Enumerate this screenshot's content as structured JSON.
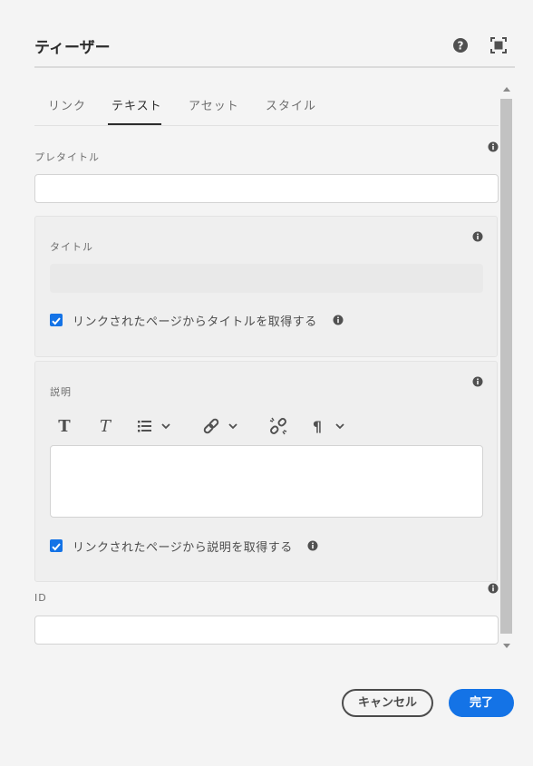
{
  "dialog": {
    "title": "ティーザー",
    "help_icon": "help-circle-icon",
    "fullscreen_icon": "fullscreen-icon"
  },
  "tabs": [
    {
      "label": "リンク",
      "active": false
    },
    {
      "label": "テキスト",
      "active": true
    },
    {
      "label": "アセット",
      "active": false
    },
    {
      "label": "スタイル",
      "active": false
    }
  ],
  "fields": {
    "pretitle": {
      "label": "プレタイトル",
      "value": ""
    },
    "title": {
      "label": "タイトル",
      "value": "",
      "disabled": true,
      "from_page_checkbox": {
        "label": "リンクされたページからタイトルを取得する",
        "checked": true
      }
    },
    "description": {
      "label": "説明",
      "value": "",
      "toolbar": [
        "bold-icon",
        "italic-icon",
        "list-icon",
        "link-icon",
        "unlink-icon",
        "paragraph-icon"
      ],
      "from_page_checkbox": {
        "label": "リンクされたページから説明を取得する",
        "checked": true
      }
    },
    "id": {
      "label": "ID",
      "value": ""
    }
  },
  "footer": {
    "cancel_label": "キャンセル",
    "done_label": "完了"
  },
  "colors": {
    "accent": "#1473e6",
    "background": "#f4f4f4",
    "panel": "#efefef"
  }
}
